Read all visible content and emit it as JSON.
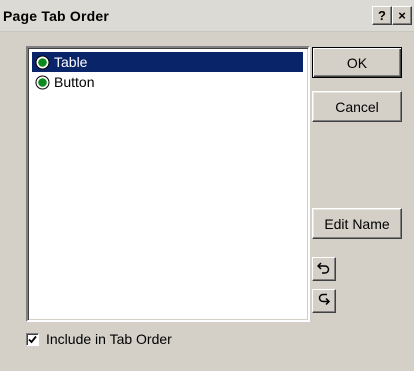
{
  "dialog": {
    "title": "Page Tab Order",
    "help_glyph": "?",
    "close_glyph": "×"
  },
  "list": {
    "items": [
      {
        "label": "Table",
        "icon": "green-radio-icon",
        "selected": true
      },
      {
        "label": "Button",
        "icon": "green-radio-icon",
        "selected": false
      }
    ]
  },
  "buttons": {
    "ok_label": "OK",
    "cancel_label": "Cancel",
    "edit_name_label": "Edit Name",
    "move_up_icon": "undo-arrow-icon",
    "move_down_icon": "redo-arrow-icon"
  },
  "checkbox": {
    "label": "Include in Tab Order",
    "checked": true
  },
  "colors": {
    "selection": "#0a246a",
    "dialog_face": "#d4d0c8",
    "radio_green": "#0a8a1c"
  }
}
